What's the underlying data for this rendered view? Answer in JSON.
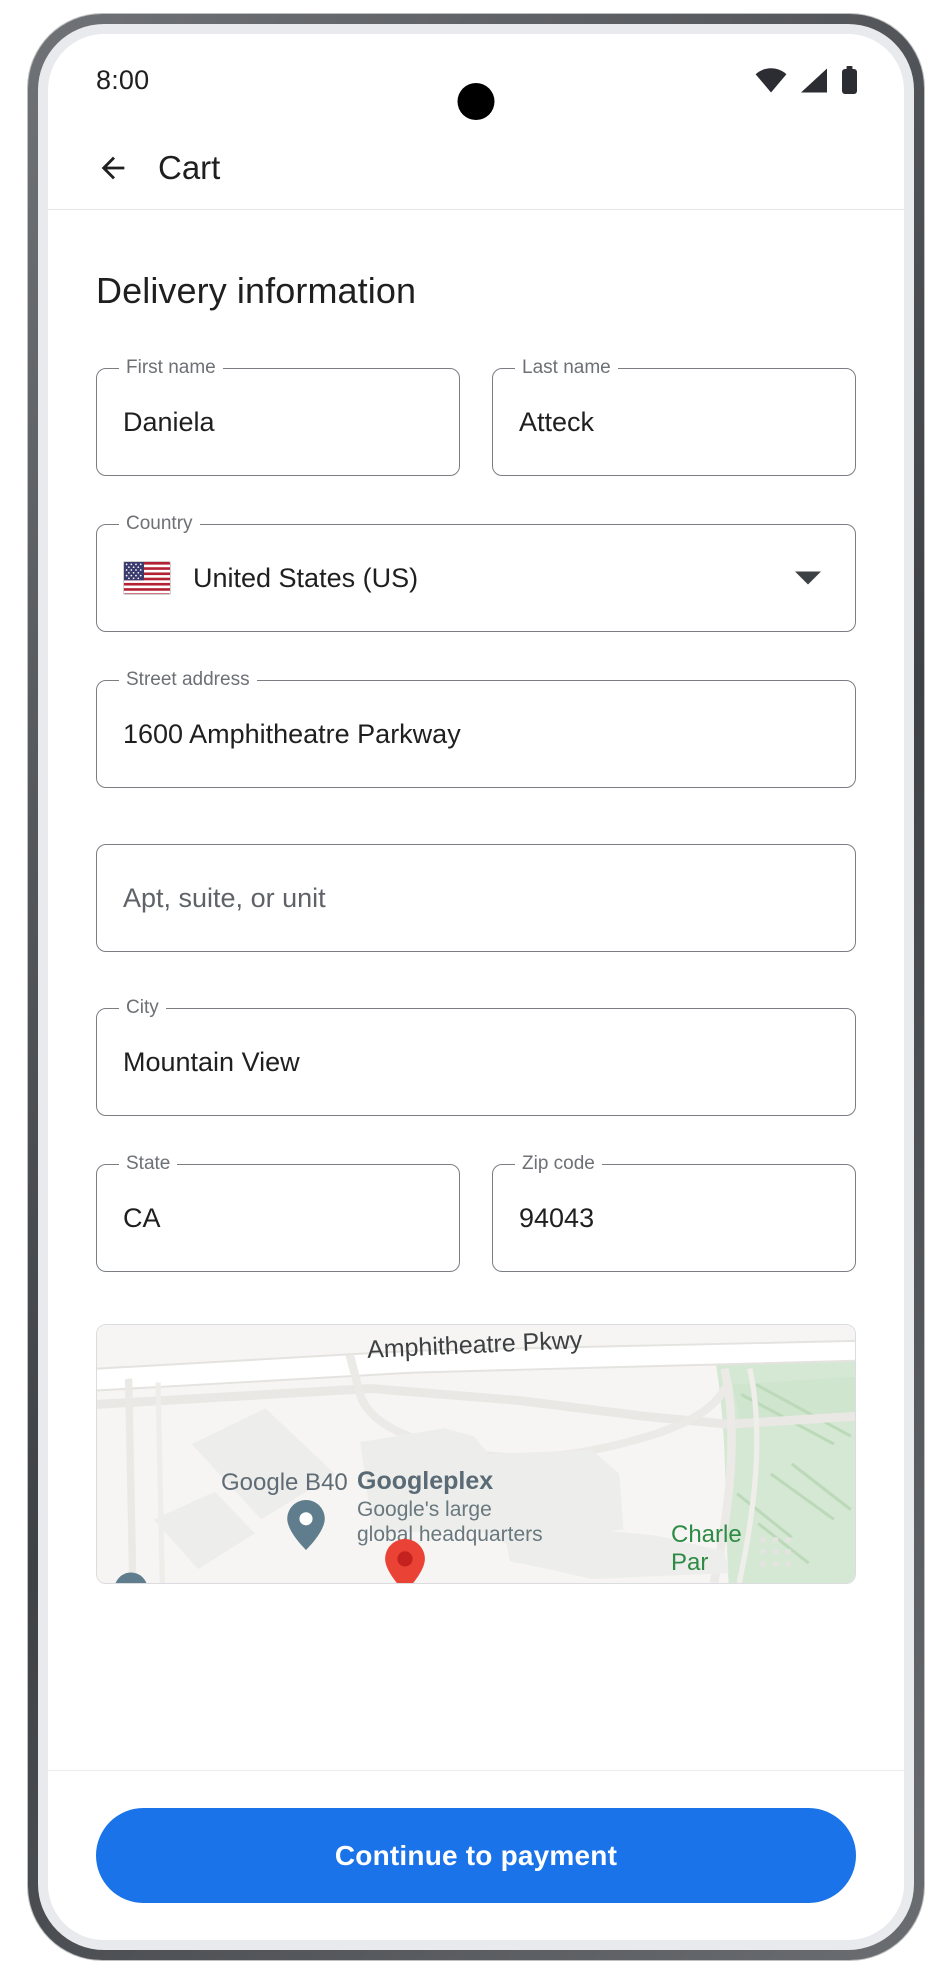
{
  "status_bar": {
    "time": "8:00",
    "icons": [
      "wifi-icon",
      "cell-signal-icon",
      "battery-icon"
    ]
  },
  "app_bar": {
    "back_icon": "back-arrow-icon",
    "title": "Cart"
  },
  "main": {
    "section_title": "Delivery information",
    "fields": {
      "first_name": {
        "label": "First name",
        "value": "Daniela"
      },
      "last_name": {
        "label": "Last name",
        "value": "Atteck"
      },
      "country": {
        "label": "Country",
        "value": "United States (US)",
        "flag": "us-flag-icon",
        "chevron": "chevron-down-icon"
      },
      "street": {
        "label": "Street address",
        "value": "1600 Amphitheatre Parkway"
      },
      "apt": {
        "label": "",
        "value": "",
        "placeholder": "Apt, suite, or unit"
      },
      "city": {
        "label": "City",
        "value": "Mountain View"
      },
      "state": {
        "label": "State",
        "value": "CA"
      },
      "zip": {
        "label": "Zip code",
        "value": "94043"
      }
    },
    "map": {
      "street_label": "Amphitheatre Pkwy",
      "building_label": "Google B40",
      "poi_title": "Googleplex",
      "poi_subtitle": "Google's large\nglobal headquarters",
      "poi_subtitle_line1": "Google's large",
      "poi_subtitle_line2": "global headquarters",
      "park_label": "Charle",
      "park_label_2": "Par",
      "pin_color": "#ea4335",
      "poi_pin_color": "#5f7d8c"
    }
  },
  "bottom_bar": {
    "continue_label": "Continue to payment",
    "accent_color": "#1a73e8"
  }
}
